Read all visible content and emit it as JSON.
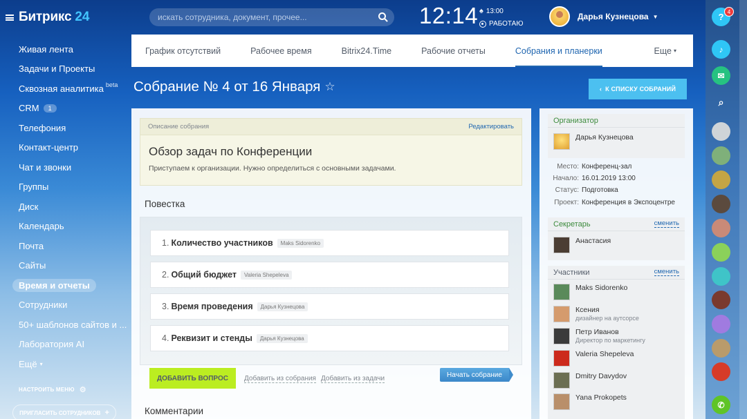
{
  "brand": {
    "name": "Битрикс",
    "num": "24"
  },
  "menu": [
    "Живая лента",
    "Задачи и Проекты",
    "Сквозная аналитика",
    "CRM",
    "Телефония",
    "Контакт-центр",
    "Чат и звонки",
    "Группы",
    "Диск",
    "Календарь",
    "Почта",
    "Сайты",
    "Время и отчеты",
    "Сотрудники",
    "50+ шаблонов сайтов и ...",
    "Лаборатория AI",
    "Ещё"
  ],
  "menu_beta": "beta",
  "menu_crm_count": "1",
  "setup_menu": "НАСТРОИТЬ МЕНЮ",
  "invite": "ПРИГЛАСИТЬ СОТРУДНИКОВ",
  "search": {
    "placeholder": "искать сотрудника, документ, прочее..."
  },
  "clock": "12:14",
  "alarm": "13:00",
  "work_status": "РАБОТАЮ",
  "user": {
    "name": "Дарья Кузнецова"
  },
  "help_badge": "4",
  "tabs": [
    "График отсутствий",
    "Рабочее время",
    "Bitrix24.Time",
    "Рабочие отчеты",
    "Собрания и планерки",
    "Еще"
  ],
  "title": "Собрание № 4 от 16 Января",
  "back": "К СПИСКУ СОБРАНИЙ",
  "desc": {
    "header": "Описание собрания",
    "edit": "Редактировать",
    "title": "Обзор задач по Конференции",
    "text": "Приступаем к организации. Нужно определиться с основными задачами."
  },
  "agenda_label": "Повестка",
  "agenda": [
    {
      "n": "1.",
      "t": "Количество участников",
      "who": "Maks Sidorenko"
    },
    {
      "n": "2.",
      "t": "Общий бюджет",
      "who": "Valeria Shepeleva"
    },
    {
      "n": "3.",
      "t": "Время проведения",
      "who": "Дарья Кузнецова"
    },
    {
      "n": "4.",
      "t": "Реквизит и стенды",
      "who": "Дарья Кузнецова"
    }
  ],
  "add_question": "ДОБАВИТЬ ВОПРОС",
  "add_from_meeting": "Добавить из собрания",
  "add_from_task": "Добавить из задачи",
  "start": "Начать собрание",
  "comments": "Комментарии",
  "organizer": {
    "label": "Организатор",
    "name": "Дарья Кузнецова"
  },
  "details": [
    {
      "k": "Место:",
      "v": "Конференц-зал"
    },
    {
      "k": "Начало:",
      "v": "16.01.2019 13:00"
    },
    {
      "k": "Статус:",
      "v": "Подготовка"
    },
    {
      "k": "Проект:",
      "v": "Конференция в Экспоцентре"
    }
  ],
  "secretary": {
    "label": "Секретарь",
    "change": "сменить",
    "name": "Анастасия"
  },
  "participants": {
    "label": "Участники",
    "change": "сменить",
    "list": [
      {
        "name": "Maks Sidorenko",
        "pos": ""
      },
      {
        "name": "Ксения",
        "pos": "дизайнер на аутсорсе"
      },
      {
        "name": "Петр Иванов",
        "pos": "Директор по маркетингу"
      },
      {
        "name": "Valeria Shepeleva",
        "pos": ""
      },
      {
        "name": "Dmitry Davydov",
        "pos": ""
      },
      {
        "name": "Yana Prokopets",
        "pos": ""
      }
    ]
  }
}
